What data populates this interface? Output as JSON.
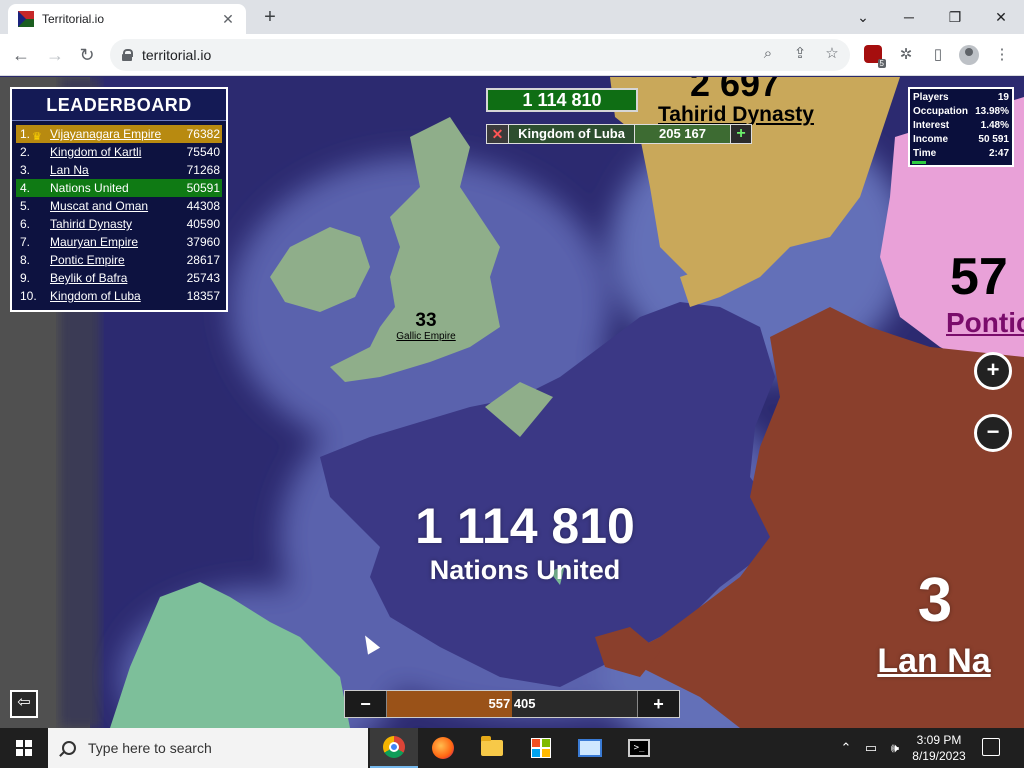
{
  "browser": {
    "tab_title": "Territorial.io",
    "url": "territorial.io",
    "new_tab_label": "+",
    "close_tab": "✕",
    "extension_badge": "5"
  },
  "game": {
    "leaderboard": {
      "title": "LEADERBOARD",
      "rows": [
        {
          "rank": "1.",
          "name": "Vijayanagara Empire",
          "score": "76382"
        },
        {
          "rank": "2.",
          "name": "Kingdom of Kartli",
          "score": "75540"
        },
        {
          "rank": "3.",
          "name": "Lan Na",
          "score": "71268"
        },
        {
          "rank": "4.",
          "name": "Nations United",
          "score": "50591"
        },
        {
          "rank": "5.",
          "name": "Muscat and Oman",
          "score": "44308"
        },
        {
          "rank": "6.",
          "name": "Tahirid Dynasty",
          "score": "40590"
        },
        {
          "rank": "7.",
          "name": "Mauryan Empire",
          "score": "37960"
        },
        {
          "rank": "8.",
          "name": "Pontic Empire",
          "score": "28617"
        },
        {
          "rank": "9.",
          "name": "Beylik of Bafra",
          "score": "25743"
        },
        {
          "rank": "10.",
          "name": "Kingdom of Luba",
          "score": "18357"
        }
      ]
    },
    "top_balance": "1 114 810",
    "target": {
      "close_symbol": "✕",
      "name": "Kingdom of Luba",
      "value": "205 167",
      "add_symbol": "+"
    },
    "stats": [
      {
        "label": "Players",
        "value": "19"
      },
      {
        "label": "Occupation",
        "value": "13.98%"
      },
      {
        "label": "Interest",
        "value": "1.48%"
      },
      {
        "label": "Income",
        "value": "50 591"
      },
      {
        "label": "Time",
        "value": "2:47"
      }
    ],
    "occupation_fraction": 0.1398,
    "zoom_in": "+",
    "zoom_out": "−",
    "labels": {
      "tahirid_num": "2 697",
      "tahirid_name": "Tahirid Dynasty",
      "gallic_num": "33",
      "gallic_name": "Gallic Empire",
      "pontic_num": "57",
      "pontic_name": "Pontic",
      "player_num": "1 114 810",
      "player_name": "Nations United",
      "lanna_num": "3",
      "lanna_name": "Lan Na"
    },
    "troop_slider": {
      "minus": "−",
      "plus": "+",
      "value_a": "557",
      "value_b": "405",
      "fill_fraction": 0.5
    },
    "exit_icon": "⇦"
  },
  "taskbar": {
    "search_placeholder": "Type here to search",
    "time": "3:09 PM",
    "date": "8/19/2023"
  },
  "colors": {
    "ocean_deep": "#2c2a70",
    "ocean_shallow": "#5b62a8",
    "player_territory": "#3d3a85",
    "gallic_empire": "#8fae8a",
    "tahirid_dynasty": "#c9a85a",
    "lan_na": "#8a3f2c",
    "pontic": "#e9a1d8",
    "teal_land": "#7dbf9a"
  }
}
